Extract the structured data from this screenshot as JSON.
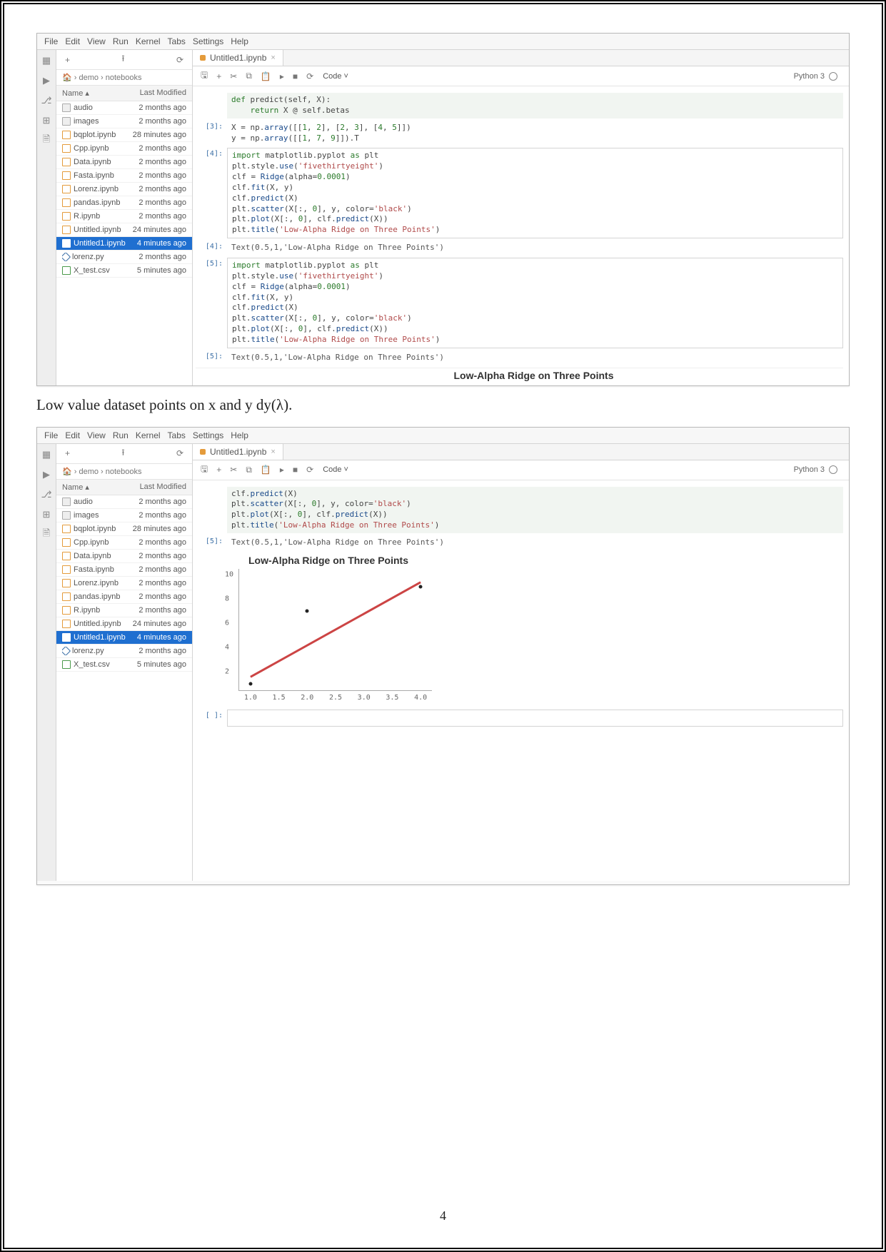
{
  "menu": [
    "File",
    "Edit",
    "View",
    "Run",
    "Kernel",
    "Tabs",
    "Settings",
    "Help"
  ],
  "rail_icons": [
    "folder-icon",
    "run-icon",
    "git-icon",
    "extensions-icon",
    "doc-icon"
  ],
  "sidebar": {
    "toolbar_icons": {
      "add": "+",
      "upload": "⭱",
      "refresh": "⟳"
    },
    "breadcrumbs": "🏠 › demo › notebooks",
    "columns": {
      "name": "Name",
      "mod": "Last Modified",
      "arrow": "▴"
    },
    "items": [
      {
        "name": "audio",
        "mod": "2 months ago",
        "type": "fo"
      },
      {
        "name": "images",
        "mod": "2 months ago",
        "type": "fo"
      },
      {
        "name": "bqplot.ipynb",
        "mod": "28 minutes ago",
        "type": "nb"
      },
      {
        "name": "Cpp.ipynb",
        "mod": "2 months ago",
        "type": "nb"
      },
      {
        "name": "Data.ipynb",
        "mod": "2 months ago",
        "type": "nb"
      },
      {
        "name": "Fasta.ipynb",
        "mod": "2 months ago",
        "type": "nb"
      },
      {
        "name": "Lorenz.ipynb",
        "mod": "2 months ago",
        "type": "nb"
      },
      {
        "name": "pandas.ipynb",
        "mod": "2 months ago",
        "type": "nb"
      },
      {
        "name": "R.ipynb",
        "mod": "2 months ago",
        "type": "nb"
      },
      {
        "name": "Untitled.ipynb",
        "mod": "24 minutes ago",
        "type": "nb"
      },
      {
        "name": "Untitled1.ipynb",
        "mod": "4 minutes ago",
        "type": "nb",
        "selected": true
      },
      {
        "name": "lorenz.py",
        "mod": "2 months ago",
        "type": "py"
      },
      {
        "name": "X_test.csv",
        "mod": "5 minutes ago",
        "type": "csv"
      }
    ]
  },
  "tab": {
    "title": "Untitled1.ipynb",
    "close": "×"
  },
  "toolbar": {
    "save": "🖫",
    "add": "+",
    "cut": "✂",
    "copy": "⧉",
    "paste": "📋",
    "run": "▸",
    "stop": "■",
    "restart": "⟳",
    "cell_type": "Code",
    "caret": "˅"
  },
  "kernel": {
    "name": "Python 3"
  },
  "shot1_cells": [
    {
      "prompt": "",
      "html": "<span class='kw'>def</span> predict(self, X):\n    <span class='kw'>return</span> X @ self.betas",
      "box": false,
      "fade": true
    },
    {
      "prompt": "[3]:",
      "html": "X = np.<span class='fn'>array</span>([[<span class='num'>1</span>, <span class='num'>2</span>], [<span class='num'>2</span>, <span class='num'>3</span>], [<span class='num'>4</span>, <span class='num'>5</span>]])\ny = np.<span class='fn'>array</span>([[<span class='num'>1</span>, <span class='num'>7</span>, <span class='num'>9</span>]]).T",
      "box": false
    },
    {
      "prompt": "[4]:",
      "html": "<span class='kw'>import</span> matplotlib.pyplot <span class='kw'>as</span> plt\nplt.style.<span class='fn'>use</span>(<span class='str'>'fivethirtyeight'</span>)\n\nclf = <span class='fn'>Ridge</span>(alpha=<span class='num'>0.0001</span>)\nclf.<span class='fn'>fit</span>(X, y)\nclf.<span class='fn'>predict</span>(X)\n\nplt.<span class='fn'>scatter</span>(X[:, <span class='num'>0</span>], y, color=<span class='str'>'black'</span>)\nplt.<span class='fn'>plot</span>(X[:, <span class='num'>0</span>], clf.<span class='fn'>predict</span>(X))\nplt.<span class='fn'>title</span>(<span class='str'>'Low-Alpha Ridge on Three Points'</span>)",
      "box": true
    },
    {
      "prompt": "[4]:",
      "html": "Text(0.5,1,'Low-Alpha Ridge on Three Points')",
      "box": false,
      "out": true
    },
    {
      "prompt": "[5]:",
      "html": "<span class='kw'>import</span> matplotlib.pyplot <span class='kw'>as</span> plt\nplt.style.<span class='fn'>use</span>(<span class='str'>'fivethirtyeight'</span>)\n\nclf = <span class='fn'>Ridge</span>(alpha=<span class='num'>0.0001</span>)\nclf.<span class='fn'>fit</span>(X, y)\nclf.<span class='fn'>predict</span>(X)\n\nplt.<span class='fn'>scatter</span>(X[:, <span class='num'>0</span>], y, color=<span class='str'>'black'</span>)\nplt.<span class='fn'>plot</span>(X[:, <span class='num'>0</span>], clf.<span class='fn'>predict</span>(X))\nplt.<span class='fn'>title</span>(<span class='str'>'Low-Alpha Ridge on Three Points'</span>)",
      "box": true
    },
    {
      "prompt": "[5]:",
      "html": "Text(0.5,1,'Low-Alpha Ridge on Three Points')",
      "box": false,
      "out": true
    }
  ],
  "shot1_bottom": "Low-Alpha Ridge on Three Points",
  "caption": "Low value dataset points on x and y dy(λ).",
  "shot2_cells": [
    {
      "prompt": "",
      "html": "clf.<span class='fn'>predict</span>(X)\n\nplt.<span class='fn'>scatter</span>(X[:, <span class='num'>0</span>], y, color=<span class='str'>'black'</span>)\nplt.<span class='fn'>plot</span>(X[:, <span class='num'>0</span>], clf.<span class='fn'>predict</span>(X))\nplt.<span class='fn'>title</span>(<span class='str'>'Low-Alpha Ridge on Three Points'</span>)",
      "box": false,
      "fade": true
    },
    {
      "prompt": "[5]:",
      "html": "Text(0.5,1,'Low-Alpha Ridge on Three Points')",
      "box": false,
      "out": true
    }
  ],
  "chart_data": {
    "type": "scatter+line",
    "title": "Low-Alpha Ridge on Three Points",
    "x_ticks": [
      1.0,
      1.5,
      2.0,
      2.5,
      3.0,
      3.5,
      4.0
    ],
    "y_ticks": [
      2,
      4,
      6,
      8,
      10
    ],
    "xlim": [
      0.8,
      4.2
    ],
    "ylim": [
      0.5,
      10.5
    ],
    "scatter": [
      {
        "x": 1,
        "y": 1
      },
      {
        "x": 2,
        "y": 7
      },
      {
        "x": 4,
        "y": 9
      }
    ],
    "line": [
      {
        "x": 1,
        "y": 1.6
      },
      {
        "x": 4,
        "y": 9.4
      }
    ]
  },
  "pageNumber": "4"
}
